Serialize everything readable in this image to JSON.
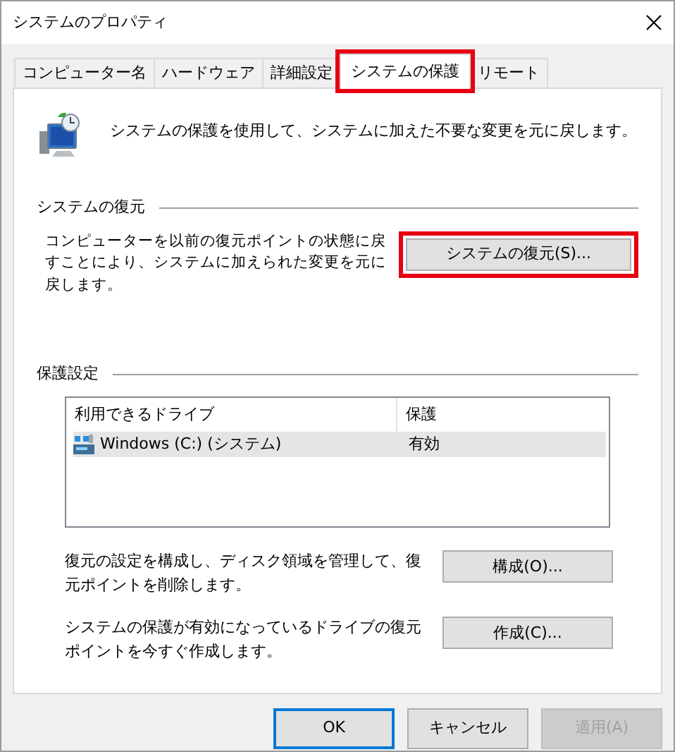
{
  "window": {
    "title": "システムのプロパティ"
  },
  "tabs": [
    {
      "label": "コンピューター名",
      "selected": false,
      "highlighted": false
    },
    {
      "label": "ハードウェア",
      "selected": false,
      "highlighted": false
    },
    {
      "label": "詳細設定",
      "selected": false,
      "highlighted": false
    },
    {
      "label": "システムの保護",
      "selected": true,
      "highlighted": true
    },
    {
      "label": "リモート",
      "selected": false,
      "highlighted": false
    }
  ],
  "intro": {
    "text": "システムの保護を使用して、システムに加えた不要な変更を元に戻します。"
  },
  "restore_section": {
    "title": "システムの復元",
    "description": "コンピューターを以前の復元ポイントの状態に戻すことにより、システムに加えられた変更を元に戻します。",
    "button": {
      "label": "システムの復元(S)...",
      "highlighted": true
    }
  },
  "protection_section": {
    "title": "保護設定",
    "table": {
      "columns": [
        "利用できるドライブ",
        "保護"
      ],
      "rows": [
        {
          "drive": "Windows (C:) (システム)",
          "protection": "有効",
          "selected": true
        }
      ]
    },
    "actions": [
      {
        "description": "復元の設定を構成し、ディスク領域を管理して、復元ポイントを削除します。",
        "button": {
          "label": "構成(O)..."
        }
      },
      {
        "description": "システムの保護が有効になっているドライブの復元ポイントを今すぐ作成します。",
        "button": {
          "label": "作成(C)..."
        }
      }
    ]
  },
  "footer_buttons": [
    {
      "label": "OK",
      "default": true,
      "disabled": false
    },
    {
      "label": "キャンセル",
      "default": false,
      "disabled": false
    },
    {
      "label": "適用(A)",
      "default": false,
      "disabled": true
    }
  ]
}
